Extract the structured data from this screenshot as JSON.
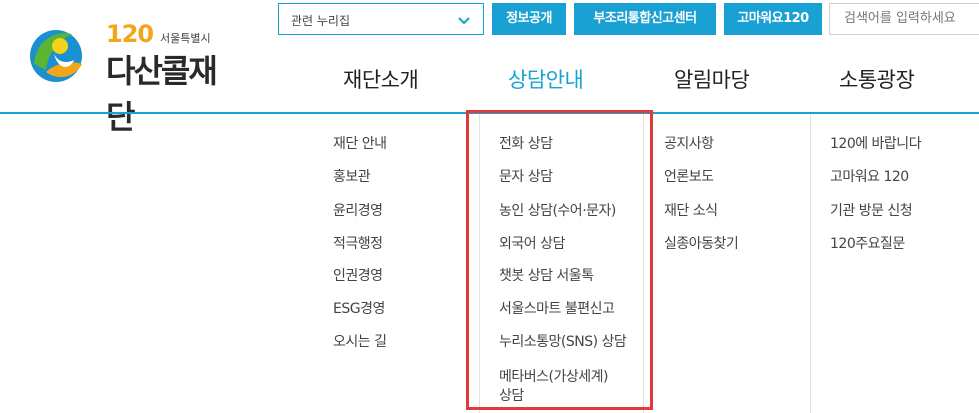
{
  "logo": {
    "number": "120",
    "subtitle": "서울특별시",
    "name": "다산콜재단"
  },
  "topbar": {
    "select_value": "관련 누리집",
    "buttons": [
      "정보공개",
      "부조리통합신고센터",
      "고마워요120"
    ],
    "search_placeholder": "검색어를 입력하세요"
  },
  "gnb": {
    "items": [
      "재단소개",
      "상담안내",
      "알림마당",
      "소통광장"
    ],
    "active_index": 1
  },
  "submenu": {
    "col1": [
      "재단 안내",
      "홍보관",
      "윤리경영",
      "적극행정",
      "인권경영",
      "ESG경영",
      "오시는 길"
    ],
    "col2": [
      "전화 상담",
      "문자 상담",
      "농인 상담(수어·문자)",
      "외국어 상담",
      "챗봇 상담 서울톡",
      "서울스마트 불편신고",
      "누리소통망(SNS) 상담",
      "메타버스(가상세계)",
      "상담"
    ],
    "col3": [
      "공지사항",
      "언론보도",
      "재단 소식",
      "실종아동찾기"
    ],
    "col4": [
      "120에 바랍니다",
      "고마워요 120",
      "기관 방문 신청",
      "120주요질문"
    ]
  },
  "colors": {
    "accent": "#1aa1d3",
    "highlight_border": "#e03a3a",
    "logo_yellow": "#f2a71b",
    "logo_green": "#5cb531",
    "logo_blue": "#1a8fd1"
  }
}
